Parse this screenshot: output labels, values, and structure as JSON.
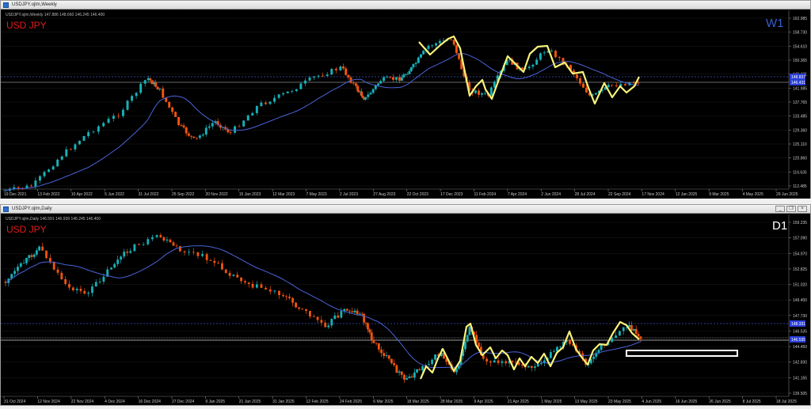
{
  "weekly": {
    "title": "USDJPY.ojlm,Weekly",
    "info": "USDJPY.ojlm,Weekly  147.886 148.660 146.245 146.400",
    "symbol_label": "USD JPY",
    "tf_label": "W1",
    "tf_color": "#3b5fd1",
    "price_ticks": [
      "162.985",
      "158.730",
      "154.610",
      "150.365",
      "146.431",
      "141.985",
      "137.765",
      "133.485",
      "129.360",
      "125.110",
      "120.860",
      "116.635",
      "112.485"
    ],
    "price_badges": [
      {
        "text": "148.837",
        "color": "#2b3fd6"
      },
      {
        "text": "146.431",
        "color": "#2b3fd6"
      }
    ],
    "date_ticks": [
      "19 Dec 2021",
      "13 Feb 2022",
      "10 Apr 2022",
      "5 Jun 2022",
      "31 Jul 2022",
      "25 Sep 2022",
      "20 Nov 2022",
      "15 Jan 2023",
      "12 Mar 2023",
      "7 May 2023",
      "2 Jul 2023",
      "27 Aug 2023",
      "22 Oct 2023",
      "17 Dec 2023",
      "11 Feb 2024",
      "7 Apr 2024",
      "2 Jun 2024",
      "28 Jul 2024",
      "22 Sep 2024",
      "17 Nov 2024",
      "12 Jan 2025",
      "9 Mar 2025",
      "4 May 2025",
      "29 Jun 2025"
    ]
  },
  "daily": {
    "title": "USDJPY.ojlm,Daily",
    "info": "USDJPY.ojlm,Daily  146.591 146.939 146.245 146.400",
    "symbol_label": "USD JPY",
    "tf_label": "D1",
    "tf_color": "#ffffff",
    "price_ticks": [
      "159.235",
      "157.090",
      "154.970",
      "152.825",
      "151.020",
      "149.400",
      "147.730",
      "146.535",
      "144.450",
      "142.830",
      "141.165",
      "139.505"
    ],
    "price_badges": [
      {
        "text": "148.331",
        "color": "#2b3fd6"
      },
      {
        "text": "146.535",
        "color": "#2b3fd6"
      }
    ],
    "date_ticks": [
      "31 Oct 2024",
      "12 Nov 2024",
      "22 Nov 2024",
      "4 Dec 2024",
      "16 Dec 2024",
      "27 Dec 2024",
      "9 Jan 2025",
      "21 Jan 2025",
      "31 Jan 2025",
      "12 Feb 2025",
      "24 Feb 2025",
      "6 Mar 2025",
      "18 Mar 2025",
      "28 Mar 2025",
      "9 Apr 2025",
      "21 Apr 2025",
      "1 May 2025",
      "13 May 2025",
      "23 May 2025",
      "4 Jun 2025",
      "16 Jun 2025",
      "26 Jun 2025",
      "8 Jul 2025",
      "18 Jul 2025"
    ]
  },
  "window_buttons": {
    "minimize": "_",
    "restore": "❐",
    "close": "×"
  },
  "colors": {
    "bull": "#17b1b8",
    "bear": "#f2540f",
    "ma": "#4a63d8",
    "zigzag": "#f7f27a",
    "grid": "#1c1c1c",
    "axis_text": "#c8c8c8"
  }
}
